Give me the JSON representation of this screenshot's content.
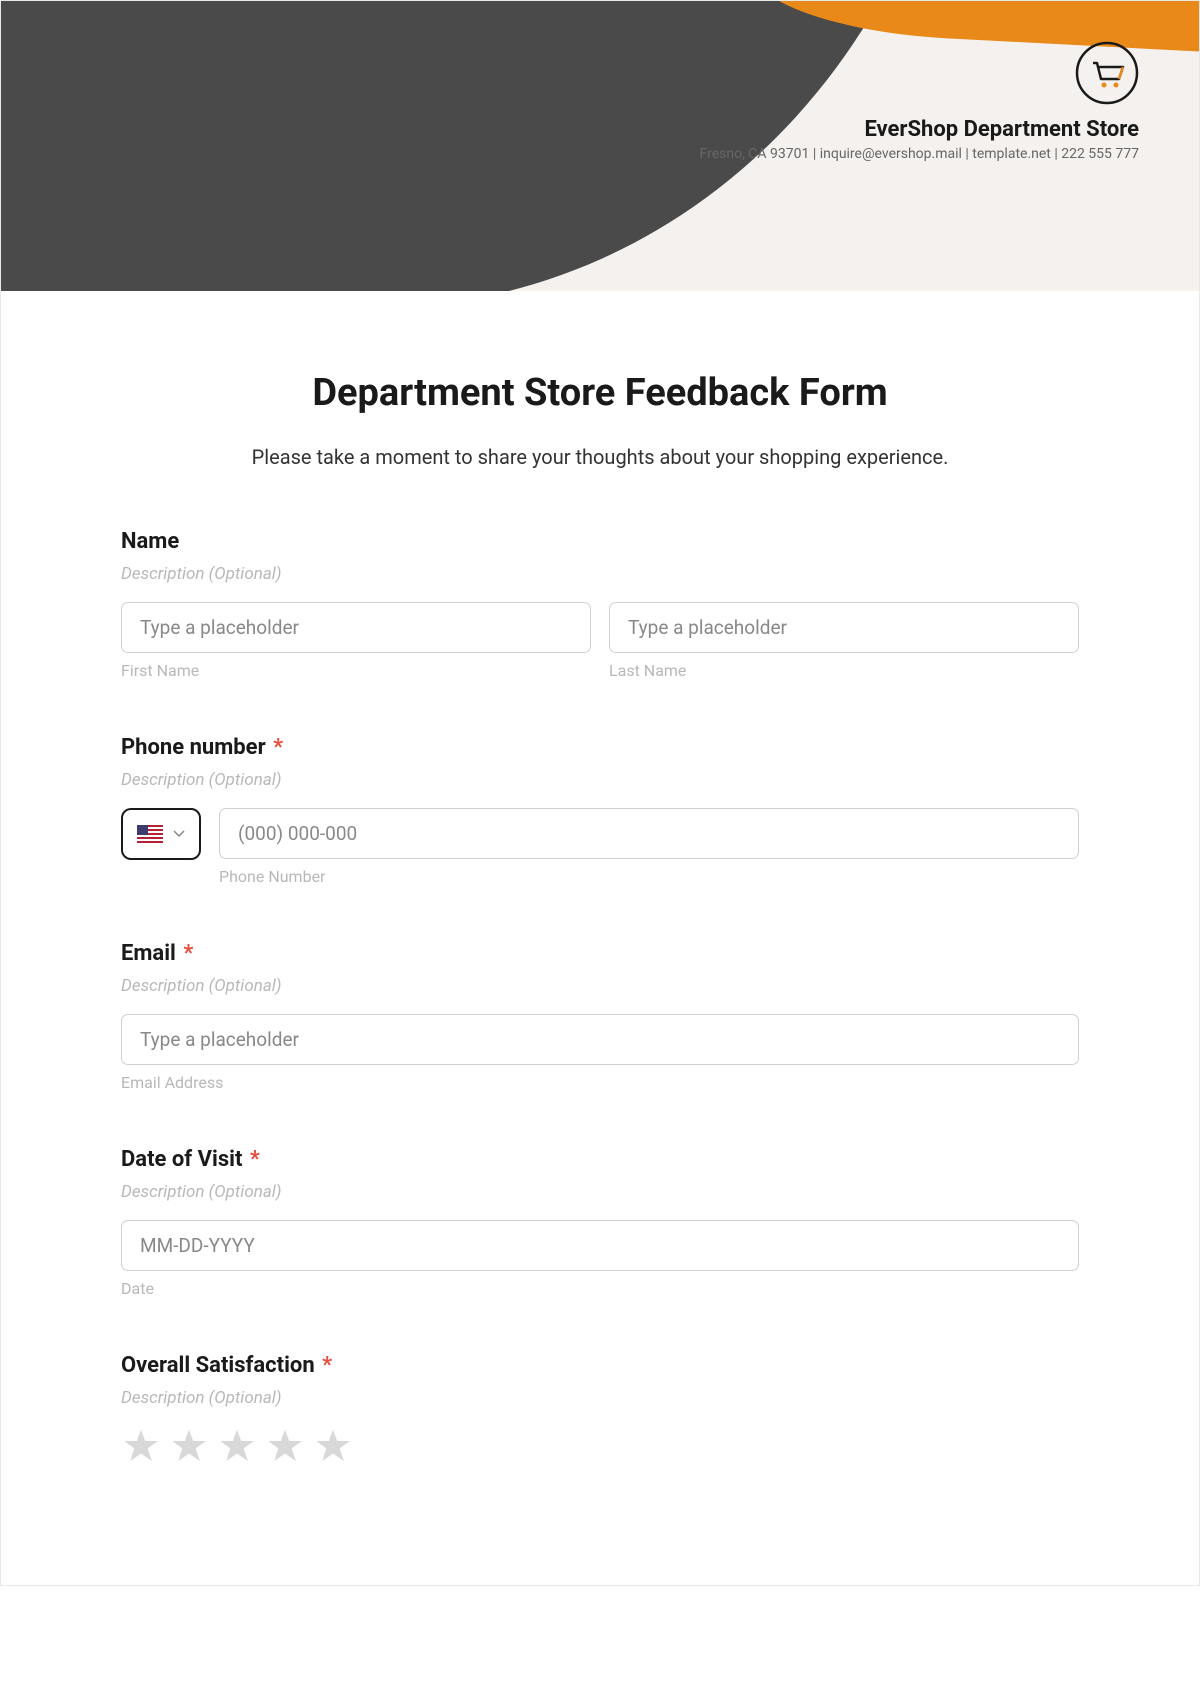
{
  "header": {
    "company_name": "EverShop Department Store",
    "company_details": "Fresno, CA 93701 | inquire@evershop.mail | template.net | 222 555 777",
    "logo_icon": "shopping-cart-icon"
  },
  "form": {
    "title": "Department Store Feedback Form",
    "subtitle": "Please take a moment to share your thoughts about your shopping experience.",
    "sections": {
      "name": {
        "label": "Name",
        "required": false,
        "description": "Description (Optional)",
        "first_name_placeholder": "Type a placeholder",
        "first_name_sublabel": "First Name",
        "last_name_placeholder": "Type a placeholder",
        "last_name_sublabel": "Last Name"
      },
      "phone": {
        "label": "Phone number",
        "required": true,
        "description": "Description (Optional)",
        "placeholder": "(000) 000-000",
        "sublabel": "Phone Number"
      },
      "email": {
        "label": "Email",
        "required": true,
        "description": "Description (Optional)",
        "placeholder": "Type a placeholder",
        "sublabel": "Email Address"
      },
      "date": {
        "label": "Date of Visit",
        "required": true,
        "description": "Description (Optional)",
        "placeholder": "MM-DD-YYYY",
        "sublabel": "Date"
      },
      "satisfaction": {
        "label": "Overall Satisfaction",
        "required": true,
        "description": "Description (Optional)",
        "rating_value": 0,
        "rating_max": 5
      }
    }
  },
  "common": {
    "required_marker": "*"
  }
}
